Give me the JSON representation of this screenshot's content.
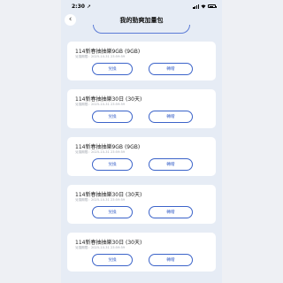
{
  "status_bar": {
    "time": "2:30",
    "location_glyph": "➚"
  },
  "navbar": {
    "title": "我的勁爽加量包",
    "back_glyph": "‹"
  },
  "cards": [
    {
      "name": "114新春抽抽樂9GB (9GB)",
      "date": "兌換期限：2025-10-31 23:59:59",
      "redeem": "兌換",
      "transfer": "轉贈"
    },
    {
      "name": "114新春抽抽樂30日 (30天)",
      "date": "兌換期限：2025-10-31 23:59:59",
      "redeem": "兌換",
      "transfer": "轉贈"
    },
    {
      "name": "114新春抽抽樂9GB (9GB)",
      "date": "兌換期限：2025-10-31 23:59:59",
      "redeem": "兌換",
      "transfer": "轉贈"
    },
    {
      "name": "114新春抽抽樂30日 (30天)",
      "date": "兌換期限：2025-10-31 23:59:59",
      "redeem": "兌換",
      "transfer": "轉贈"
    },
    {
      "name": "114新春抽抽樂30日 (30天)",
      "date": "兌換期限：2025-10-31 23:59:59",
      "redeem": "兌換",
      "transfer": "轉贈"
    }
  ]
}
